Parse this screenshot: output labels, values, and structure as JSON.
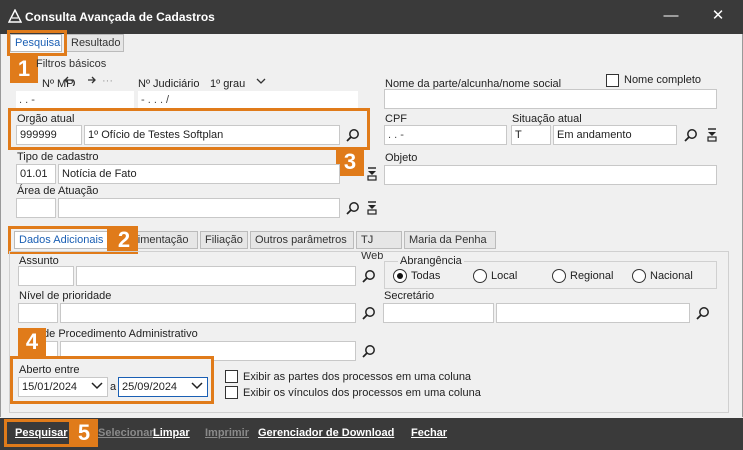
{
  "window": {
    "title": "Consulta Avançada de Cadastros",
    "minimize": "—",
    "close": "✕"
  },
  "top_tabs": [
    {
      "label": "Pesquisa",
      "active": true
    },
    {
      "label": "Resultado",
      "active": false
    }
  ],
  "basic_filters": {
    "legend": "Filtros básicos",
    "process_number_label": "Nº MP",
    "process_number_value": ". . -",
    "judicial_label": "Nº Judiciário",
    "instance": "1º grau",
    "judicial_value": "- . . . /",
    "party_name_label": "Nome da parte/alcunha/nome social",
    "full_name_label": "Nome completo",
    "organ_label": "Orgão atual",
    "organ_code": "999999",
    "organ_name": "1º Ofício de Testes Softplan",
    "cpf_label": "CPF",
    "cpf_value": ". . -",
    "status_label": "Situação atual",
    "status_code": "T",
    "status_name": "Em andamento",
    "type_label": "Tipo de cadastro",
    "type_code": "01.01",
    "type_name": "Notícia de Fato",
    "object_label": "Objeto",
    "area_label": "Área de Atuação"
  },
  "sub_tabs": [
    {
      "label": "Dados Adicionais",
      "active": true
    },
    {
      "label": "Movimentação",
      "active": false
    },
    {
      "label": "Filiação",
      "active": false
    },
    {
      "label": "Outros parâmetros",
      "active": false
    },
    {
      "label": "TJ Web",
      "active": false
    },
    {
      "label": "Maria da Penha",
      "active": false
    }
  ],
  "additional": {
    "subject_label": "Assunto",
    "scope_label": "Abrangência",
    "scope_options": [
      {
        "label": "Todas",
        "selected": true
      },
      {
        "label": "Local",
        "selected": false
      },
      {
        "label": "Regional",
        "selected": false
      },
      {
        "label": "Nacional",
        "selected": false
      }
    ],
    "priority_label": "Nível de prioridade",
    "secretary_label": "Secretário",
    "admin_proc_label": "Tipo de Procedimento Administrativo",
    "opened_label": "Aberto entre",
    "date_from": "15/01/2024",
    "date_sep": "a",
    "date_to": "25/09/2024",
    "opt_parties": "Exibir as partes dos processos em uma coluna",
    "opt_links": "Exibir os vínculos dos processos em uma coluna"
  },
  "bottom_buttons": [
    {
      "label": "Pesquisar",
      "enabled": true
    },
    {
      "label": "Selecionar",
      "enabled": false
    },
    {
      "label": "Limpar",
      "enabled": true
    },
    {
      "label": "Imprimir",
      "enabled": false
    },
    {
      "label": "Gerenciador de Download",
      "enabled": true
    },
    {
      "label": "Fechar",
      "enabled": true
    }
  ],
  "callouts": [
    "1",
    "2",
    "3",
    "4",
    "5"
  ],
  "colors": {
    "accent": "#e07b1a",
    "titlebar": "#3a3a3a",
    "active_tab_text": "#1a5fb4"
  }
}
